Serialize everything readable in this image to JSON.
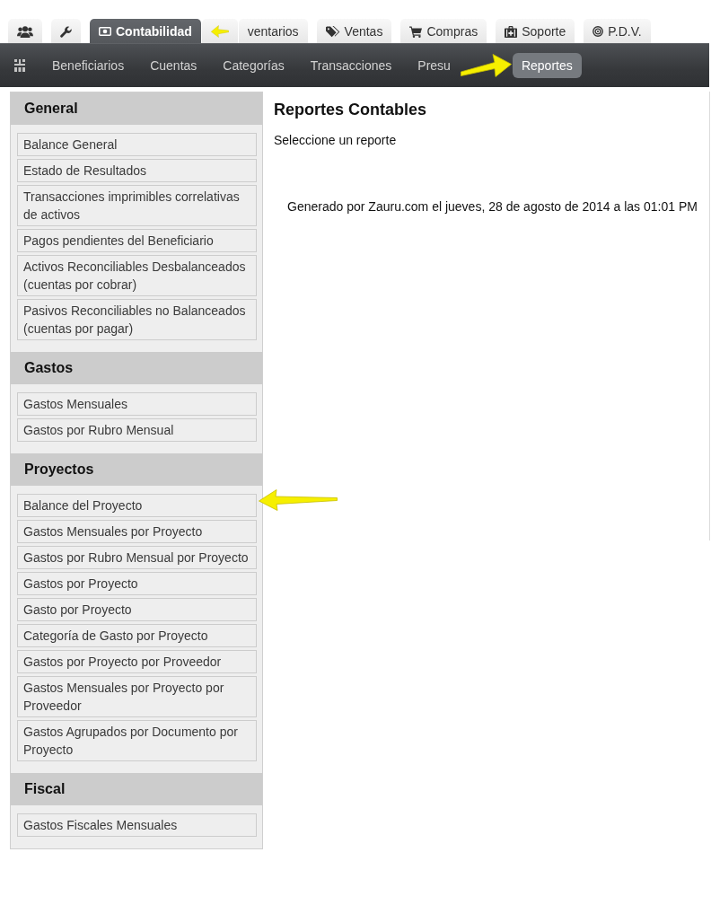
{
  "tabs": [
    {
      "selected": false,
      "callout_arrow": false
    },
    {
      "selected": false,
      "callout_arrow": false
    },
    {
      "label": "Contabilidad",
      "selected": true,
      "callout_arrow": true
    },
    {
      "label": "ventarios",
      "selected": false,
      "callout_arrow": false
    },
    {
      "label": "Ventas",
      "selected": false,
      "callout_arrow": false
    },
    {
      "label": "Compras",
      "selected": false,
      "callout_arrow": false
    },
    {
      "label": "Soporte",
      "selected": false,
      "callout_arrow": false
    },
    {
      "label": "P.D.V.",
      "selected": false,
      "callout_arrow": false
    }
  ],
  "nav": {
    "items": [
      {
        "label": "Beneficiarios",
        "selected": false,
        "callout_arrow": false
      },
      {
        "label": "Cuentas",
        "selected": false,
        "callout_arrow": false
      },
      {
        "label": "Categorías",
        "selected": false,
        "callout_arrow": false
      },
      {
        "label": "Transacciones",
        "selected": false,
        "callout_arrow": false
      },
      {
        "label": "Presu",
        "selected": false,
        "callout_arrow": false
      },
      {
        "label": "Reportes",
        "selected": true,
        "callout_arrow": true
      }
    ]
  },
  "sidebar": {
    "sections": [
      {
        "title": "General",
        "items": [
          {
            "label": "Balance General",
            "callout_arrow": false
          },
          {
            "label": "Estado de Resultados",
            "callout_arrow": false
          },
          {
            "label": "Transacciones imprimibles correlativas de activos",
            "callout_arrow": false
          },
          {
            "label": "Pagos pendientes del Beneficiario",
            "callout_arrow": false
          },
          {
            "label": "Activos Reconciliables Desbalanceados (cuentas por cobrar)",
            "callout_arrow": false
          },
          {
            "label": "Pasivos Reconciliables no Balanceados (cuentas por pagar)",
            "callout_arrow": false
          }
        ]
      },
      {
        "title": "Gastos",
        "items": [
          {
            "label": "Gastos Mensuales",
            "callout_arrow": false
          },
          {
            "label": "Gastos por Rubro Mensual",
            "callout_arrow": false
          }
        ]
      },
      {
        "title": "Proyectos",
        "items": [
          {
            "label": "Balance del Proyecto",
            "callout_arrow": true
          },
          {
            "label": "Gastos Mensuales por Proyecto",
            "callout_arrow": false
          },
          {
            "label": "Gastos por Rubro Mensual por Proyecto",
            "callout_arrow": false
          },
          {
            "label": "Gastos por Proyecto",
            "callout_arrow": false
          },
          {
            "label": "Gasto por Proyecto",
            "callout_arrow": false
          },
          {
            "label": "Categoría de Gasto por Proyecto",
            "callout_arrow": false
          },
          {
            "label": "Gastos por Proyecto por Proveedor",
            "callout_arrow": false
          },
          {
            "label": "Gastos Mensuales por Proyecto por Proveedor",
            "callout_arrow": false
          },
          {
            "label": "Gastos Agrupados por Documento por Proyecto",
            "callout_arrow": false
          }
        ]
      },
      {
        "title": "Fiscal",
        "items": [
          {
            "label": "Gastos Fiscales Mensuales",
            "callout_arrow": false
          }
        ]
      }
    ]
  },
  "content": {
    "title": "Reportes Contables",
    "prompt": "Seleccione un reporte",
    "footer": "Generado por Zauru.com el jueves, 28 de agosto de 2014 a las 01:01 PM"
  }
}
